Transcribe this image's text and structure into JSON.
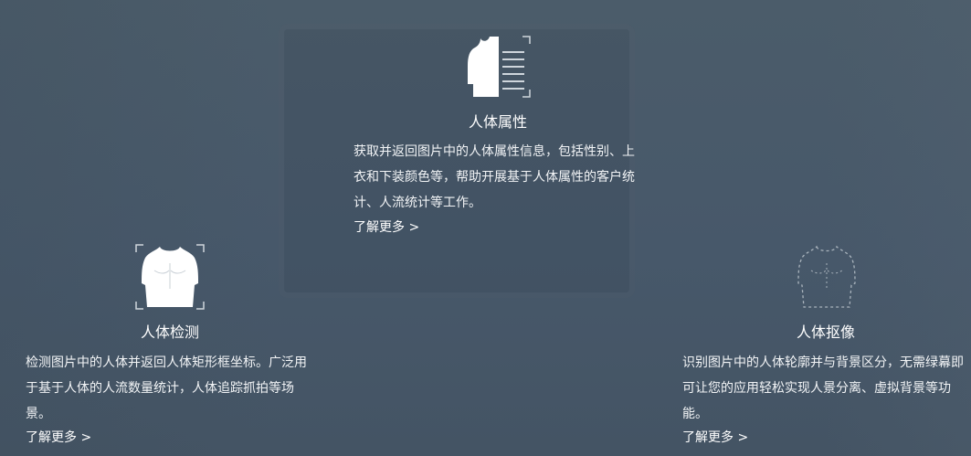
{
  "features": {
    "attribute": {
      "icon": "torso-attribute-icon",
      "title": "人体属性",
      "description": "获取并返回图片中的人体属性信息，包括性别、上衣和下装颜色等，帮助开展基于人体属性的客户统计、人流统计等工作。",
      "more_label": "了解更多 >"
    },
    "detection": {
      "icon": "torso-detection-icon",
      "title": "人体检测",
      "description": "检测图片中的人体并返回人体矩形框坐标。广泛用于基于人体的人流数量统计，人体追踪抓拍等场景。",
      "more_label": "了解更多 >"
    },
    "matting": {
      "icon": "torso-outline-icon",
      "title": "人体抠像",
      "description": "识别图片中的人体轮廓并与背景区分，无需绿幕即可让您的应用轻松实现人景分离、虚拟背景等功能。",
      "more_label": "了解更多 >"
    }
  },
  "colors": {
    "background": "#47586a",
    "text": "#ffffff"
  }
}
